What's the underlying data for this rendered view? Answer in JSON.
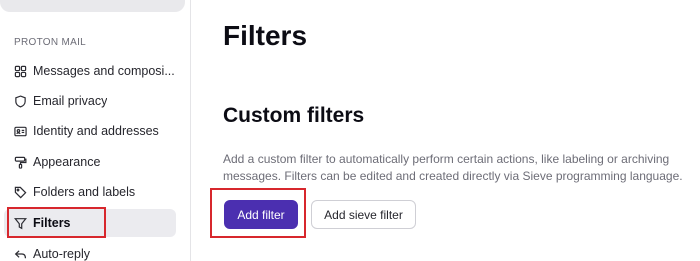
{
  "sidebar": {
    "section_label": "PROTON MAIL",
    "items": [
      {
        "label": "Messages and composi...",
        "icon": "grid-icon"
      },
      {
        "label": "Email privacy",
        "icon": "shield-icon"
      },
      {
        "label": "Identity and addresses",
        "icon": "id-card-icon"
      },
      {
        "label": "Appearance",
        "icon": "paint-roller-icon"
      },
      {
        "label": "Folders and labels",
        "icon": "tag-icon"
      },
      {
        "label": "Filters",
        "icon": "filter-icon",
        "active": true
      },
      {
        "label": "Auto-reply",
        "icon": "reply-icon"
      }
    ]
  },
  "main": {
    "title": "Filters",
    "section_title": "Custom filters",
    "description": "Add a custom filter to automatically perform certain actions, like labeling or archiving messages. Filters can be edited and created directly via Sieve programming language.",
    "add_filter_label": "Add filter",
    "add_sieve_filter_label": "Add sieve filter"
  },
  "colors": {
    "accent": "#4b2fb0",
    "highlight": "#d7272d"
  }
}
